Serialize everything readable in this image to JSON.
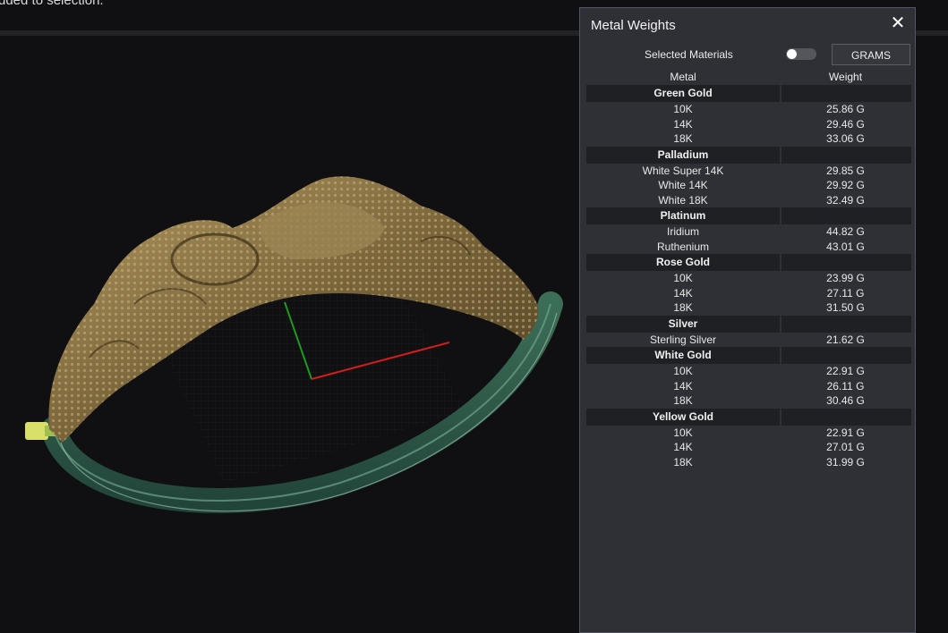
{
  "status_text": "dded to selection.",
  "panel": {
    "title": "Metal Weights",
    "close_glyph": "✕",
    "selected_materials_label": "Selected Materials",
    "toggle_on": false,
    "units_button": "GRAMS",
    "columns": [
      "Metal",
      "Weight"
    ],
    "groups": [
      {
        "name": "Green Gold",
        "rows": [
          {
            "metal": "10K",
            "weight": "25.86 G"
          },
          {
            "metal": "14K",
            "weight": "29.46 G"
          },
          {
            "metal": "18K",
            "weight": "33.06 G"
          }
        ]
      },
      {
        "name": "Palladium",
        "rows": [
          {
            "metal": "White Super 14K",
            "weight": "29.85 G"
          },
          {
            "metal": "White 14K",
            "weight": "29.92 G"
          },
          {
            "metal": "White 18K",
            "weight": "32.49 G"
          }
        ]
      },
      {
        "name": "Platinum",
        "rows": [
          {
            "metal": "Iridium",
            "weight": "44.82 G"
          },
          {
            "metal": "Ruthenium",
            "weight": "43.01 G"
          }
        ]
      },
      {
        "name": "Rose Gold",
        "rows": [
          {
            "metal": "10K",
            "weight": "23.99 G"
          },
          {
            "metal": "14K",
            "weight": "27.11 G"
          },
          {
            "metal": "18K",
            "weight": "31.50 G"
          }
        ]
      },
      {
        "name": "Silver",
        "rows": [
          {
            "metal": "Sterling Silver",
            "weight": "21.62 G"
          }
        ]
      },
      {
        "name": "White Gold",
        "rows": [
          {
            "metal": "10K",
            "weight": "22.91 G"
          },
          {
            "metal": "14K",
            "weight": "26.11 G"
          },
          {
            "metal": "18K",
            "weight": "30.46 G"
          }
        ]
      },
      {
        "name": "Yellow Gold",
        "rows": [
          {
            "metal": "10K",
            "weight": "22.91 G"
          },
          {
            "metal": "14K",
            "weight": "27.01 G"
          },
          {
            "metal": "18K",
            "weight": "31.99 G"
          }
        ]
      }
    ]
  },
  "viewport": {
    "model": "bracelet-model",
    "colors": {
      "background": "#101012",
      "gold": "#8a7447",
      "band": "#2f5a46",
      "axis_x": "#d21d1d",
      "axis_y": "#1c9a1c"
    }
  }
}
